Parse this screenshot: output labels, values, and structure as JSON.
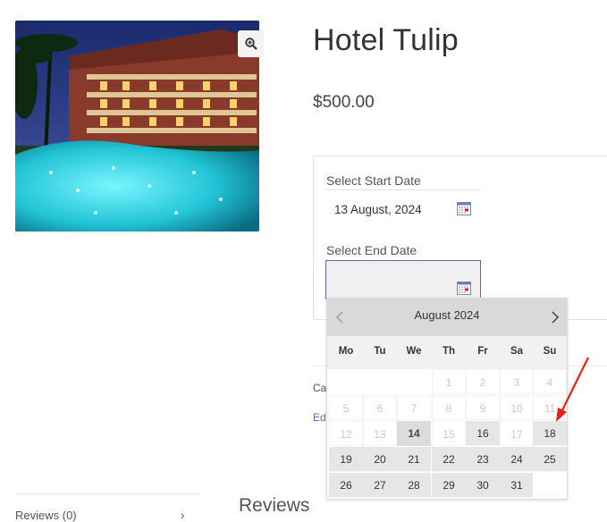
{
  "product": {
    "title": "Hotel Tulip",
    "price": "$500.00"
  },
  "booking": {
    "start_label": "Select Start Date",
    "start_value": "13 August, 2024",
    "end_label": "Select End Date",
    "end_value": ""
  },
  "meta": {
    "category_prefix": "Cat",
    "edit_prefix": "Edi"
  },
  "tabs": {
    "reviews_tab": "Reviews (0)",
    "reviews_heading": "Reviews"
  },
  "datepicker": {
    "month_title": "August 2024",
    "weekdays": [
      "Mo",
      "Tu",
      "We",
      "Th",
      "Fr",
      "Sa",
      "Su"
    ],
    "weeks": [
      [
        {
          "d": "",
          "s": "empty"
        },
        {
          "d": "",
          "s": "empty"
        },
        {
          "d": "",
          "s": "empty"
        },
        {
          "d": "1",
          "s": "disabled"
        },
        {
          "d": "2",
          "s": "disabled"
        },
        {
          "d": "3",
          "s": "disabled"
        },
        {
          "d": "4",
          "s": "disabled"
        }
      ],
      [
        {
          "d": "5",
          "s": "disabled"
        },
        {
          "d": "6",
          "s": "disabled"
        },
        {
          "d": "7",
          "s": "disabled"
        },
        {
          "d": "8",
          "s": "disabled"
        },
        {
          "d": "9",
          "s": "disabled"
        },
        {
          "d": "10",
          "s": "disabled"
        },
        {
          "d": "11",
          "s": "disabled"
        }
      ],
      [
        {
          "d": "12",
          "s": "disabled"
        },
        {
          "d": "13",
          "s": "disabled"
        },
        {
          "d": "14",
          "s": "today"
        },
        {
          "d": "15",
          "s": "disabled"
        },
        {
          "d": "16",
          "s": "active"
        },
        {
          "d": "17",
          "s": "disabled"
        },
        {
          "d": "18",
          "s": "active"
        }
      ],
      [
        {
          "d": "19",
          "s": "active"
        },
        {
          "d": "20",
          "s": "active"
        },
        {
          "d": "21",
          "s": "active"
        },
        {
          "d": "22",
          "s": "active"
        },
        {
          "d": "23",
          "s": "active"
        },
        {
          "d": "24",
          "s": "active"
        },
        {
          "d": "25",
          "s": "active"
        }
      ],
      [
        {
          "d": "26",
          "s": "active"
        },
        {
          "d": "27",
          "s": "active"
        },
        {
          "d": "28",
          "s": "active"
        },
        {
          "d": "29",
          "s": "active"
        },
        {
          "d": "30",
          "s": "active"
        },
        {
          "d": "31",
          "s": "active"
        },
        {
          "d": "",
          "s": "empty"
        }
      ]
    ]
  },
  "colors": {
    "accent": "#7f54b3",
    "annotation_arrow": "#e8221b",
    "header_bg": "#d9d9d9"
  },
  "icons": [
    "zoom-in-icon",
    "calendar-icon",
    "chevron-left-icon",
    "chevron-right-icon",
    "chevron-down-icon",
    "annotation-arrow-icon"
  ]
}
